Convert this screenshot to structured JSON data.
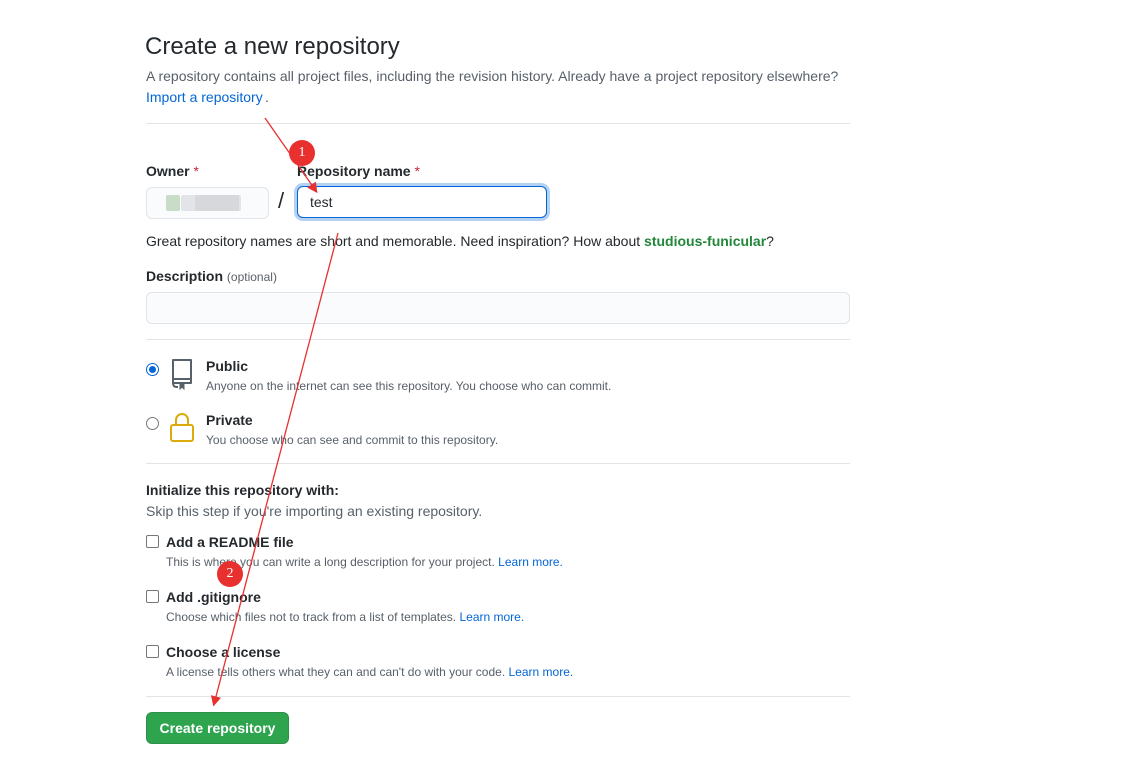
{
  "header": {
    "title": "Create a new repository",
    "subtitle": "A repository contains all project files, including the revision history. Already have a project repository elsewhere?",
    "import_link": "Import a repository",
    "import_period": "."
  },
  "form": {
    "owner_label": "Owner",
    "required_mark": "*",
    "repo_name_label": "Repository name",
    "repo_name_value": "test",
    "slash": "/",
    "hint_prefix": "Great repository names are short and memorable. Need inspiration? How about ",
    "hint_suggestion": "studious-funicular",
    "hint_suffix": "?",
    "description_label": "Description",
    "description_optional": "(optional)",
    "description_value": ""
  },
  "visibility": {
    "public": {
      "title": "Public",
      "desc": "Anyone on the internet can see this repository. You choose who can commit.",
      "selected": true,
      "icon": "repo-icon"
    },
    "private": {
      "title": "Private",
      "desc": "You choose who can see and commit to this repository.",
      "selected": false,
      "icon": "lock-icon"
    }
  },
  "init": {
    "heading": "Initialize this repository with:",
    "subheading": "Skip this step if you're importing an existing repository.",
    "learn_more": "Learn more.",
    "readme": {
      "title": "Add a README file",
      "desc": "This is where you can write a long description for your project."
    },
    "gitignore": {
      "title": "Add .gitignore",
      "desc": "Choose which files not to track from a list of templates."
    },
    "license": {
      "title": "Choose a license",
      "desc": "A license tells others what they can and can't do with your code."
    }
  },
  "actions": {
    "create_label": "Create repository"
  },
  "annotations": {
    "badge1": "1",
    "badge2": "2",
    "color": "#e8302f"
  },
  "colors": {
    "link": "#0366d6",
    "button": "#2ea44f",
    "suggestion": "#22863a",
    "required": "#cb2431"
  }
}
